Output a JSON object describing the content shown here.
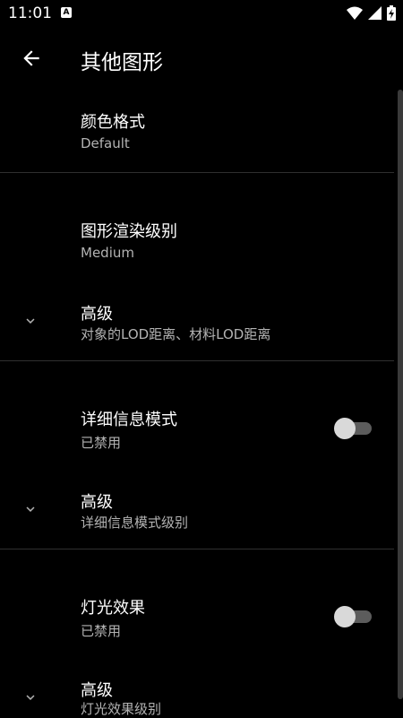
{
  "status": {
    "time": "11:01",
    "notification_icon": "A"
  },
  "header": {
    "title": "其他图形"
  },
  "items": [
    {
      "title": "颜色格式",
      "subtitle": "Default"
    },
    {
      "title": "图形渲染级别",
      "subtitle": "Medium"
    },
    {
      "title": "高级",
      "subtitle": "对象的LOD距离、材料LOD距离"
    },
    {
      "title": "详细信息模式",
      "subtitle": "已禁用",
      "enabled": false
    },
    {
      "title": "高级",
      "subtitle": "详细信息模式级别"
    },
    {
      "title": "灯光效果",
      "subtitle": "已禁用",
      "enabled": false
    },
    {
      "title": "高级",
      "subtitle": "灯光效果级别"
    }
  ],
  "icons": {
    "back": "arrow-left-icon",
    "chevron": "chevron-down-icon",
    "wifi": "wifi-icon",
    "signal": "signal-icon",
    "battery": "battery-charging-icon"
  }
}
